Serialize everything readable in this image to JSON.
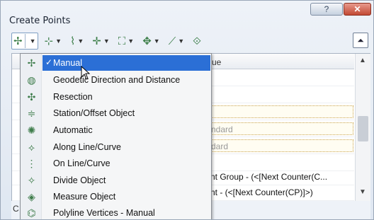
{
  "window": {
    "title": "Create Points",
    "help_label": "?",
    "close_label": "✕",
    "collapse_label": "⏶"
  },
  "toolbar": {
    "tools": [
      {
        "icon": "point-add-icon",
        "glyph": "✢"
      },
      {
        "icon": "point-line-icon",
        "glyph": "⊹"
      },
      {
        "icon": "point-curve-icon",
        "glyph": "⌇"
      },
      {
        "icon": "point-intersection-icon",
        "glyph": "✛"
      },
      {
        "icon": "point-surface-icon",
        "glyph": "⛶"
      },
      {
        "icon": "point-interpolate-icon",
        "glyph": "✥"
      },
      {
        "icon": "point-slope-icon",
        "glyph": "⟋"
      },
      {
        "icon": "point-convert-icon",
        "glyph": "⟐"
      }
    ]
  },
  "grid": {
    "column_header": "ue",
    "rows": [
      {
        "value": "",
        "boxed": false
      },
      {
        "value": "",
        "boxed": false
      },
      {
        "value": "",
        "boxed": true
      },
      {
        "value": "ndard",
        "boxed": true
      },
      {
        "value": "dard",
        "boxed": true
      },
      {
        "value": "",
        "boxed": false
      },
      {
        "value": "nt Group - (<[Next Counter(C...",
        "boxed": false
      },
      {
        "value": "nt - (<[Next Counter(CP)]>)",
        "boxed": false
      },
      {
        "value": "",
        "boxed": false
      }
    ],
    "bottom_label": "C"
  },
  "menu": {
    "selected_check": "✓",
    "items": [
      {
        "label": "Manual",
        "icon": "manual-point-icon",
        "glyph": "✢",
        "selected": true
      },
      {
        "label": "Geodetic Direction and Distance",
        "icon": "geodetic-direction-icon",
        "glyph": "◍"
      },
      {
        "label": "Resection",
        "icon": "resection-icon",
        "glyph": "✣"
      },
      {
        "label": "Station/Offset Object",
        "icon": "station-offset-icon",
        "glyph": "≑"
      },
      {
        "label": "Automatic",
        "icon": "automatic-point-icon",
        "glyph": "✺"
      },
      {
        "label": "Along Line/Curve",
        "icon": "along-line-curve-icon",
        "glyph": "⟡"
      },
      {
        "label": "On Line/Curve",
        "icon": "on-line-curve-icon",
        "glyph": "⋮"
      },
      {
        "label": "Divide Object",
        "icon": "divide-object-icon",
        "glyph": "✧"
      },
      {
        "label": "Measure Object",
        "icon": "measure-object-icon",
        "glyph": "◈"
      },
      {
        "label": "Polyline Vertices - Manual",
        "icon": "polyline-vertices-icon",
        "glyph": "⌬"
      }
    ]
  }
}
